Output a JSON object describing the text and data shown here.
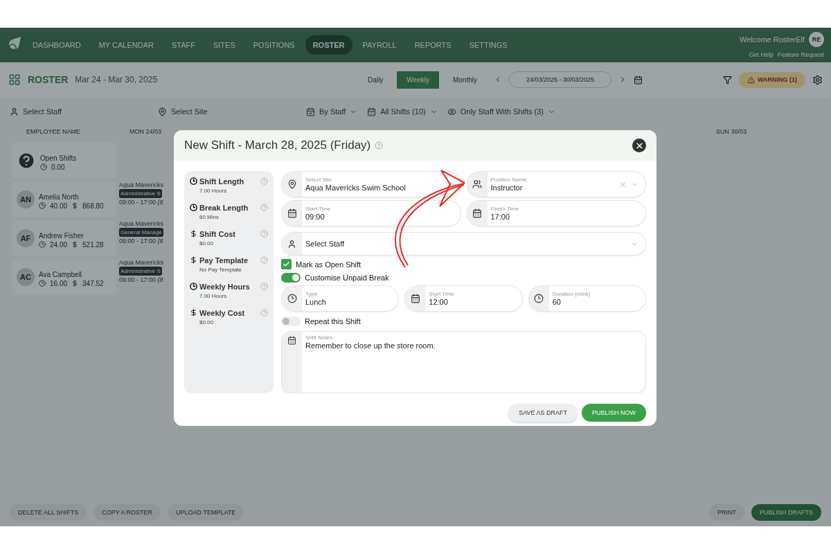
{
  "nav": {
    "items": [
      {
        "label": "DASHBOARD",
        "selected": false
      },
      {
        "label": "MY CALENDAR",
        "selected": false
      },
      {
        "label": "STAFF",
        "selected": false
      },
      {
        "label": "SITES",
        "selected": false
      },
      {
        "label": "POSITIONS",
        "selected": false
      },
      {
        "label": "ROSTER",
        "selected": true
      },
      {
        "label": "PAYROLL",
        "selected": false
      },
      {
        "label": "REPORTS",
        "selected": false
      },
      {
        "label": "SETTINGS",
        "selected": false
      }
    ],
    "welcome": "Welcome RosterElf",
    "avatar": "RE",
    "links": [
      "Get Help",
      "Feature Request"
    ]
  },
  "toolbar": {
    "title": "ROSTER",
    "date_range": "Mar 24 - Mar 30, 2025",
    "views": [
      {
        "label": "Daily",
        "selected": false
      },
      {
        "label": "Weekly",
        "selected": true
      },
      {
        "label": "Monthly",
        "selected": false
      }
    ],
    "date_field": "24/03/2025 - 30/03/2025",
    "warning": "WARNING (1)"
  },
  "filters": {
    "staff_placeholder": "Select Staff",
    "site_placeholder": "Select Site",
    "group_by": "By Staff",
    "shifts": "All Shifts (10)",
    "visibility": "Only Staff With Shifts (3)"
  },
  "table": {
    "columns": [
      "EMPLOYEE NAME",
      "MON 24/03",
      "SUN 30/03"
    ],
    "rows": [
      {
        "kind": "open",
        "name": "Open Shifts",
        "hours": "0.00"
      },
      {
        "kind": "staff",
        "initials": "AN",
        "name": "Amelia North",
        "hours": "40.00",
        "cost": "868.80",
        "shift": {
          "site": "Aqua Mavericks",
          "position": "Administrative S",
          "time": "09:00 - 17:00 *(8*"
        }
      },
      {
        "kind": "staff",
        "initials": "AF",
        "name": "Andrew Fisher",
        "hours": "24.00",
        "cost": "521.28",
        "shift": {
          "site": "Aqua Mavericks",
          "position": "General Manage",
          "time": "09:00 - 17:00 *(8*"
        }
      },
      {
        "kind": "staff",
        "initials": "AC",
        "name": "Ava Campbell",
        "hours": "16.00",
        "cost": "347.52",
        "shift": {
          "site": "Aqua Mavericks",
          "position": "Administrative S",
          "time": "09:00 - 17:00 *(8*"
        }
      }
    ]
  },
  "footer": {
    "left": [
      "DELETE ALL SHIFTS",
      "COPY A ROSTER",
      "UPLOAD TEMPLATE"
    ],
    "print": "PRINT",
    "publish": "PUBLISH DRAFTS"
  },
  "modal": {
    "title": "New Shift - March 28, 2025 (Friday)",
    "summary": [
      {
        "kind": "clock",
        "label": "Shift Length",
        "value": "7.00 Hours"
      },
      {
        "kind": "clock",
        "label": "Break Length",
        "value": "60 Mins"
      },
      {
        "kind": "money",
        "label": "Shift Cost",
        "value": "$0.00"
      },
      {
        "kind": "money",
        "label": "Pay Template",
        "value": "No Pay Template"
      },
      {
        "kind": "clock",
        "label": "Weekly Hours",
        "value": "7.00 Hours"
      },
      {
        "kind": "money",
        "label": "Weekly Cost",
        "value": "$0.00"
      }
    ],
    "site": {
      "label": "Select Site",
      "value": "Aqua Mavericks Swim School"
    },
    "position": {
      "label": "Position Name",
      "value": "Instructor"
    },
    "start": {
      "label": "Start Time",
      "value": "09:00"
    },
    "finish": {
      "label": "Finish Time",
      "value": "17:00"
    },
    "staff": {
      "placeholder": "Select Staff"
    },
    "open_shift": {
      "label": "Mark as Open Shift",
      "checked": true
    },
    "break_toggle": {
      "label": "Customise Unpaid Break",
      "on": true
    },
    "break_fields": [
      {
        "kind": "clock",
        "label": "Type",
        "value": "Lunch"
      },
      {
        "kind": "calendar",
        "label": "Start Time",
        "value": "12:00"
      },
      {
        "kind": "clock",
        "label": "Duration (mins)",
        "value": "60"
      }
    ],
    "repeat_toggle": {
      "label": "Repeat this Shift",
      "on": false
    },
    "notes": {
      "label": "Shift Notes",
      "value": "Remember to close up the store room."
    },
    "buttons": {
      "draft": "SAVE AS DRAFT",
      "publish": "PUBLISH NOW"
    }
  }
}
